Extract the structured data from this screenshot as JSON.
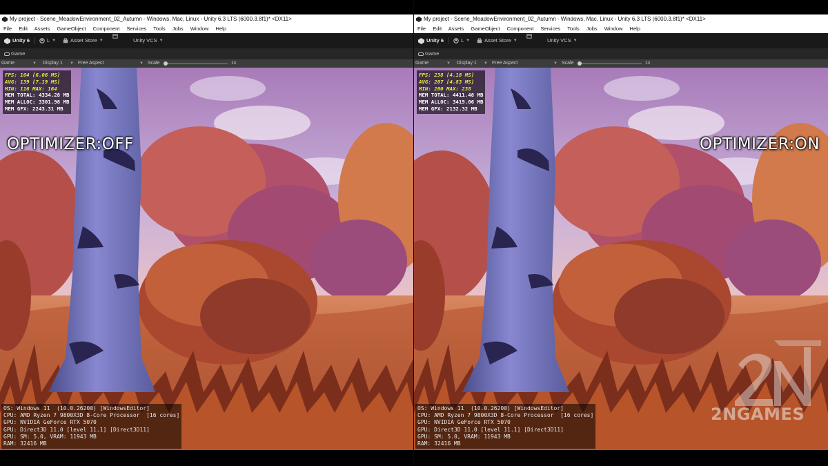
{
  "left": {
    "window_title": "My project - Scene_MeadowEnvironment_02_Autumn - Windows, Mac, Linux - Unity 6.3 LTS (6000.3.8f1)* <DX11>",
    "menu": [
      "File",
      "Edit",
      "Assets",
      "GameObject",
      "Component",
      "Services",
      "Tools",
      "Jobs",
      "Window",
      "Help"
    ],
    "toolbar": {
      "unity": "Unity 6",
      "account": "L",
      "asset_store": "Asset Store",
      "vcs": "Unity VCS"
    },
    "tab": "Game",
    "game_toolbar": {
      "mode": "Game",
      "display": "Display 1",
      "aspect": "Free Aspect",
      "scale_label": "Scale",
      "scale_value": "1x"
    },
    "stats": {
      "fps": "FPS: 164 [6.06 MS]",
      "avg": "AVG: 139 [7.19 MS]",
      "minmax": "MIN: 116 MAX: 164",
      "mem_total": "MEM TOTAL: 4334.28 MB",
      "mem_alloc": "MEM ALLOC: 3301.98 MB",
      "mem_gfx": "MEM GFX: 2243.31 MB"
    },
    "label": "OPTIMIZER:OFF",
    "sysinfo": {
      "os": "OS: Windows 11  (10.0.26200) [WindowsEditor]",
      "cpu": "CPU: AMD Ryzen 7 9800X3D 8-Core Processor  [16 cores]",
      "gpu": "GPU: NVIDIA GeForce RTX 5070",
      "gpu_api": "GPU: Direct3D 11.0 [level 11.1] [Direct3D11]",
      "gpu_sm": "GPU: SM: 5.0, VRAM: 11943 MB",
      "ram": "RAM: 32416 MB"
    }
  },
  "right": {
    "window_title": "My project - Scene_MeadowEnvironment_02_Autumn - Windows, Mac, Linux - Unity 6.3 LTS (6000.3.8f1)* <DX11>",
    "menu": [
      "File",
      "Edit",
      "Assets",
      "GameObject",
      "Component",
      "Services",
      "Tools",
      "Jobs",
      "Window",
      "Help"
    ],
    "toolbar": {
      "unity": "Unity 6",
      "account": "L",
      "asset_store": "Asset Store",
      "vcs": "Unity VCS"
    },
    "tab": "Game",
    "game_toolbar": {
      "mode": "Game",
      "display": "Display 1",
      "aspect": "Free Aspect",
      "scale_label": "Scale",
      "scale_value": "1x"
    },
    "stats": {
      "fps": "FPS: 238 [4.18 MS]",
      "avg": "AVG: 207 [4.83 MS]",
      "minmax": "MIN: 200 MAX: 238",
      "mem_total": "MEM TOTAL: 4411.48 MB",
      "mem_alloc": "MEM ALLOC: 3419.06 MB",
      "mem_gfx": "MEM GFX: 2132.32 MB"
    },
    "label": "OPTIMIZER:ON",
    "sysinfo": {
      "os": "OS: Windows 11  (10.0.26200) [WindowsEditor]",
      "cpu": "CPU: AMD Ryzen 7 9800X3D 8-Core Processor  [16 cores]",
      "gpu": "GPU: NVIDIA GeForce RTX 5070",
      "gpu_api": "GPU: Direct3D 11.0 [level 11.1] [Direct3D11]",
      "gpu_sm": "GPU: SM: 5.0, VRAM: 11943 MB",
      "ram": "RAM: 32416 MB"
    },
    "watermark": "2NGAMES"
  },
  "colors": {
    "fps_text": "#e5e94a",
    "sky": "#b9a7d8",
    "foliage": "#c95a3a",
    "trunk": "#6e6fb3"
  }
}
